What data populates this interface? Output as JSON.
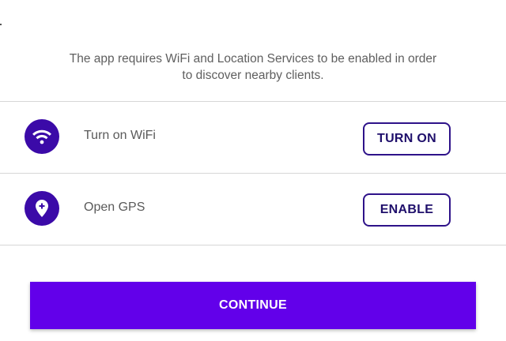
{
  "intro": {
    "line1": "The app requires WiFi and Location Services to be enabled in order",
    "line2": "to discover nearby clients."
  },
  "rows": [
    {
      "icon": "wifi-icon",
      "label": "Turn on WiFi",
      "button": "TURN ON"
    },
    {
      "icon": "location-pin-icon",
      "label": "Open GPS",
      "button": "ENABLE"
    }
  ],
  "continue_label": "CONTINUE",
  "colors": {
    "accent": "#6200ea",
    "icon_bg": "#3b0aa8",
    "button_border": "#2e1289"
  }
}
